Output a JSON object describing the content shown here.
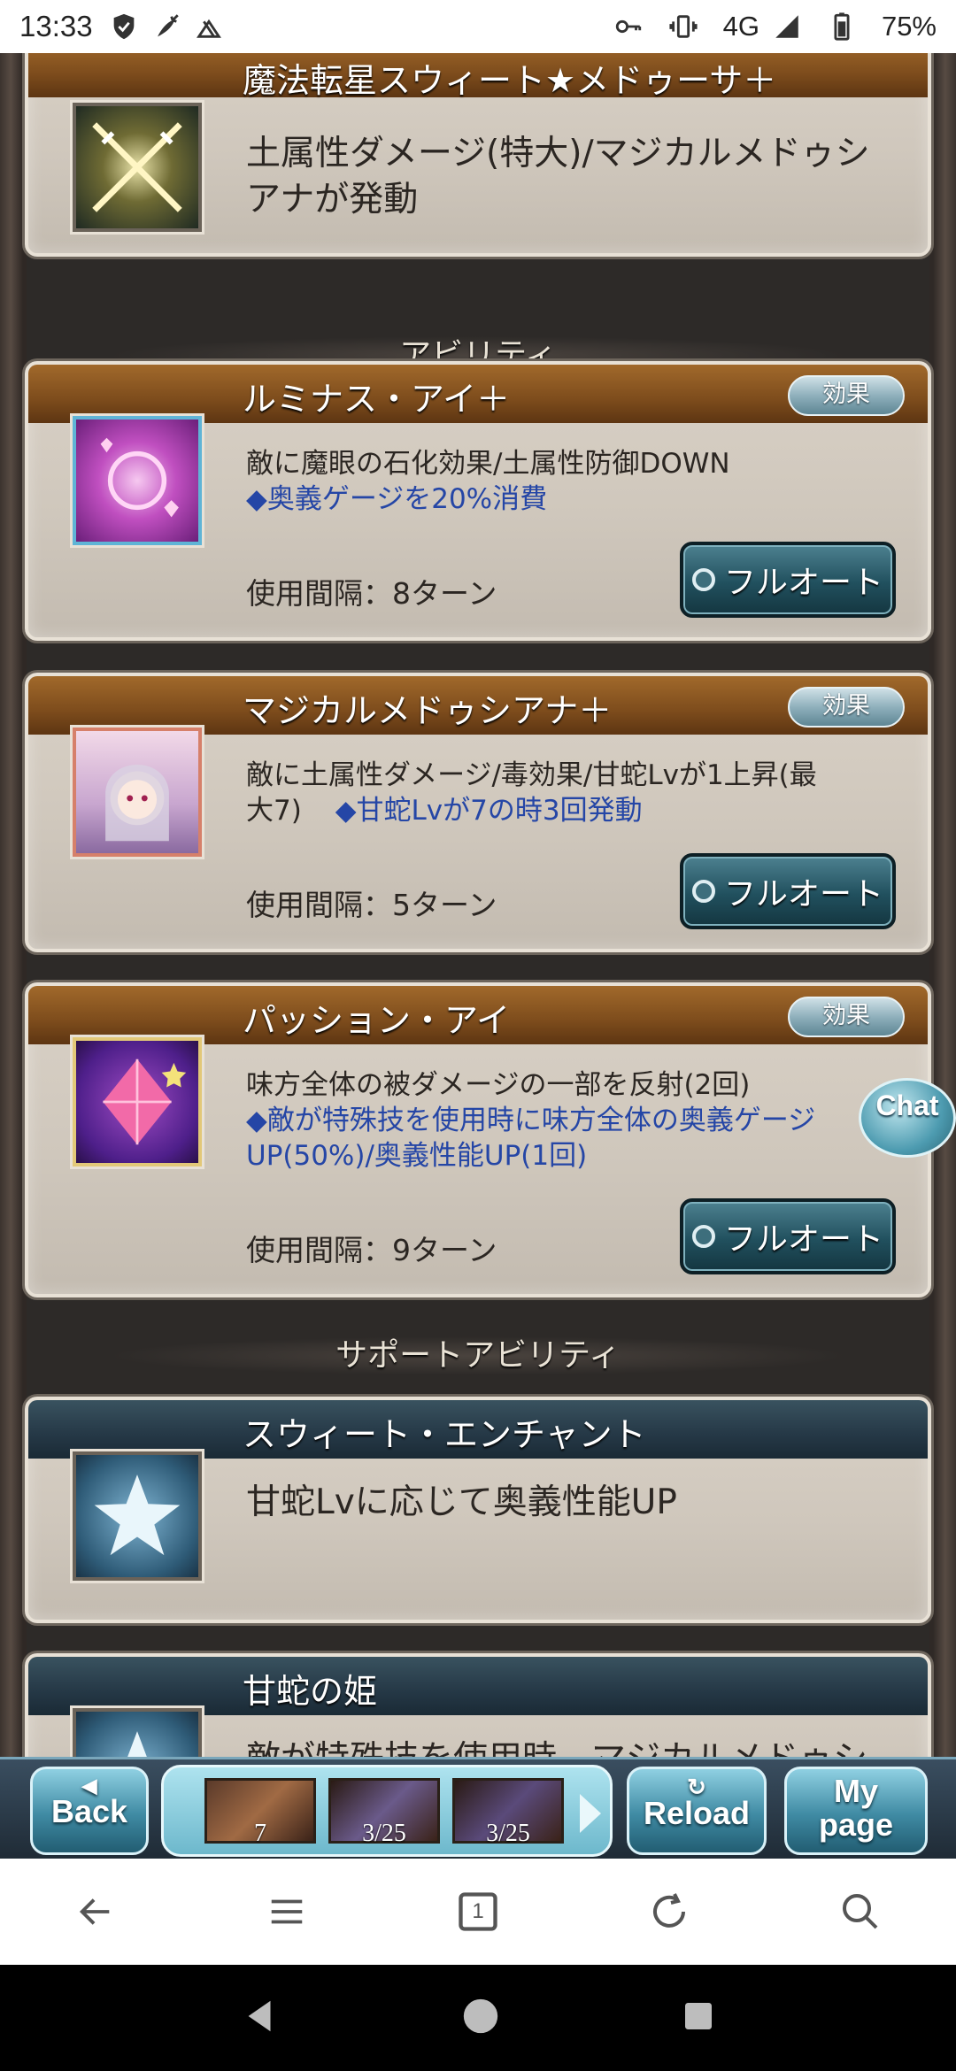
{
  "status_bar": {
    "time": "13:33",
    "network": "4G",
    "battery": "75%",
    "left_icons": [
      "shield-icon",
      "carrot-icon",
      "game-icon"
    ],
    "right_icons": [
      "key-icon",
      "vibrate-icon",
      "signal-icon",
      "battery-icon"
    ]
  },
  "top_card": {
    "title": "魔法転星スウィート★メドゥーサ＋",
    "desc_line1": "土属性ダメージ(特大)/マジカルメドゥシ",
    "desc_line2": "アナが発動",
    "icon": "crossed-swords-icon"
  },
  "sections": {
    "ability_header": "アビリティ",
    "support_header": "サポートアビリティ"
  },
  "abilities": [
    {
      "title": "ルミナス・アイ＋",
      "effect_label": "効果",
      "desc_line1": "敵に魔眼の石化効果/土属性防御DOWN",
      "desc_blue": "◆奥義ゲージを20%消費",
      "interval": "使用間隔：8ターン",
      "button": "フルオート",
      "icon": "hearts-orb-icon"
    },
    {
      "title": "マジカルメドゥシアナ＋",
      "effect_label": "効果",
      "desc_line1": "敵に土属性ダメージ/毒効果/甘蛇Lvが1上昇(最",
      "desc_line2": "大7)",
      "desc_blue_inline": "◆甘蛇Lvが7の時3回発動",
      "interval": "使用間隔：5ターン",
      "button": "フルオート",
      "icon": "character-portrait-icon"
    },
    {
      "title": "パッション・アイ",
      "effect_label": "効果",
      "desc_line1": "味方全体の被ダメージの一部を反射(2回)",
      "desc_blue_line1": "◆敵が特殊技を使用時に味方全体の奥義ゲージ",
      "desc_blue_line2": "UP(50%)/奥義性能UP(1回)",
      "interval": "使用間隔：9ターン",
      "button": "フルオート",
      "icon": "pink-crystal-icon"
    }
  ],
  "support_abilities": [
    {
      "title": "スウィート・エンチャント",
      "desc": "甘蛇Lvに応じて奥義性能UP",
      "icon": "star-icon"
    },
    {
      "title": "甘蛇の姫",
      "desc": "敵が特殊技を使用時、マジカルメドゥシ",
      "icon": "star-icon"
    }
  ],
  "chat_label": "Chat",
  "game_bar": {
    "back": "Back",
    "reload": "Reload",
    "mypage_line1": "My",
    "mypage_line2": "page",
    "slots": [
      "7",
      "3/25",
      "3/25"
    ]
  },
  "browser_bar": {
    "icons": [
      "back-arrow-icon",
      "menu-icon",
      "tabs-icon",
      "refresh-icon",
      "search-icon"
    ],
    "tab_count": "1"
  },
  "nav_bar": {
    "icons": [
      "nav-back-icon",
      "nav-home-icon",
      "nav-recents-icon"
    ]
  }
}
